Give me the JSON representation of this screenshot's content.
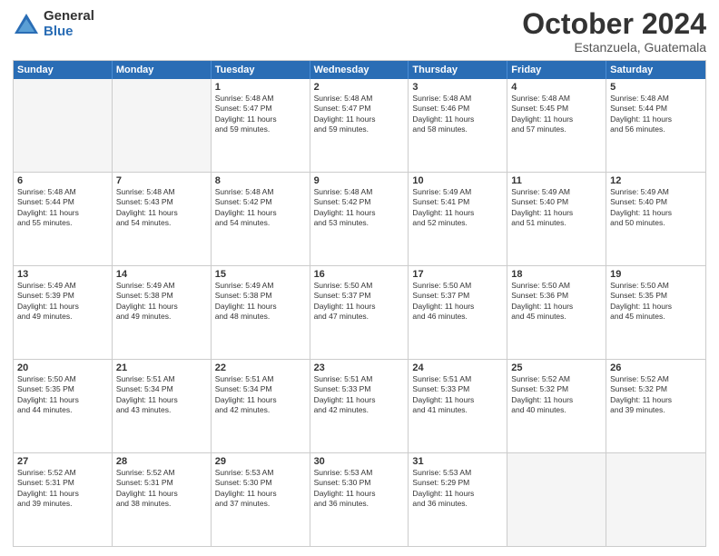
{
  "header": {
    "logo_general": "General",
    "logo_blue": "Blue",
    "month_title": "October 2024",
    "location": "Estanzuela, Guatemala"
  },
  "weekdays": [
    "Sunday",
    "Monday",
    "Tuesday",
    "Wednesday",
    "Thursday",
    "Friday",
    "Saturday"
  ],
  "rows": [
    [
      {
        "day": "",
        "empty": true,
        "lines": []
      },
      {
        "day": "",
        "empty": true,
        "lines": []
      },
      {
        "day": "1",
        "lines": [
          "Sunrise: 5:48 AM",
          "Sunset: 5:47 PM",
          "Daylight: 11 hours",
          "and 59 minutes."
        ]
      },
      {
        "day": "2",
        "lines": [
          "Sunrise: 5:48 AM",
          "Sunset: 5:47 PM",
          "Daylight: 11 hours",
          "and 59 minutes."
        ]
      },
      {
        "day": "3",
        "lines": [
          "Sunrise: 5:48 AM",
          "Sunset: 5:46 PM",
          "Daylight: 11 hours",
          "and 58 minutes."
        ]
      },
      {
        "day": "4",
        "lines": [
          "Sunrise: 5:48 AM",
          "Sunset: 5:45 PM",
          "Daylight: 11 hours",
          "and 57 minutes."
        ]
      },
      {
        "day": "5",
        "lines": [
          "Sunrise: 5:48 AM",
          "Sunset: 5:44 PM",
          "Daylight: 11 hours",
          "and 56 minutes."
        ]
      }
    ],
    [
      {
        "day": "6",
        "lines": [
          "Sunrise: 5:48 AM",
          "Sunset: 5:44 PM",
          "Daylight: 11 hours",
          "and 55 minutes."
        ]
      },
      {
        "day": "7",
        "lines": [
          "Sunrise: 5:48 AM",
          "Sunset: 5:43 PM",
          "Daylight: 11 hours",
          "and 54 minutes."
        ]
      },
      {
        "day": "8",
        "lines": [
          "Sunrise: 5:48 AM",
          "Sunset: 5:42 PM",
          "Daylight: 11 hours",
          "and 54 minutes."
        ]
      },
      {
        "day": "9",
        "lines": [
          "Sunrise: 5:48 AM",
          "Sunset: 5:42 PM",
          "Daylight: 11 hours",
          "and 53 minutes."
        ]
      },
      {
        "day": "10",
        "lines": [
          "Sunrise: 5:49 AM",
          "Sunset: 5:41 PM",
          "Daylight: 11 hours",
          "and 52 minutes."
        ]
      },
      {
        "day": "11",
        "lines": [
          "Sunrise: 5:49 AM",
          "Sunset: 5:40 PM",
          "Daylight: 11 hours",
          "and 51 minutes."
        ]
      },
      {
        "day": "12",
        "lines": [
          "Sunrise: 5:49 AM",
          "Sunset: 5:40 PM",
          "Daylight: 11 hours",
          "and 50 minutes."
        ]
      }
    ],
    [
      {
        "day": "13",
        "lines": [
          "Sunrise: 5:49 AM",
          "Sunset: 5:39 PM",
          "Daylight: 11 hours",
          "and 49 minutes."
        ]
      },
      {
        "day": "14",
        "lines": [
          "Sunrise: 5:49 AM",
          "Sunset: 5:38 PM",
          "Daylight: 11 hours",
          "and 49 minutes."
        ]
      },
      {
        "day": "15",
        "lines": [
          "Sunrise: 5:49 AM",
          "Sunset: 5:38 PM",
          "Daylight: 11 hours",
          "and 48 minutes."
        ]
      },
      {
        "day": "16",
        "lines": [
          "Sunrise: 5:50 AM",
          "Sunset: 5:37 PM",
          "Daylight: 11 hours",
          "and 47 minutes."
        ]
      },
      {
        "day": "17",
        "lines": [
          "Sunrise: 5:50 AM",
          "Sunset: 5:37 PM",
          "Daylight: 11 hours",
          "and 46 minutes."
        ]
      },
      {
        "day": "18",
        "lines": [
          "Sunrise: 5:50 AM",
          "Sunset: 5:36 PM",
          "Daylight: 11 hours",
          "and 45 minutes."
        ]
      },
      {
        "day": "19",
        "lines": [
          "Sunrise: 5:50 AM",
          "Sunset: 5:35 PM",
          "Daylight: 11 hours",
          "and 45 minutes."
        ]
      }
    ],
    [
      {
        "day": "20",
        "lines": [
          "Sunrise: 5:50 AM",
          "Sunset: 5:35 PM",
          "Daylight: 11 hours",
          "and 44 minutes."
        ]
      },
      {
        "day": "21",
        "lines": [
          "Sunrise: 5:51 AM",
          "Sunset: 5:34 PM",
          "Daylight: 11 hours",
          "and 43 minutes."
        ]
      },
      {
        "day": "22",
        "lines": [
          "Sunrise: 5:51 AM",
          "Sunset: 5:34 PM",
          "Daylight: 11 hours",
          "and 42 minutes."
        ]
      },
      {
        "day": "23",
        "lines": [
          "Sunrise: 5:51 AM",
          "Sunset: 5:33 PM",
          "Daylight: 11 hours",
          "and 42 minutes."
        ]
      },
      {
        "day": "24",
        "lines": [
          "Sunrise: 5:51 AM",
          "Sunset: 5:33 PM",
          "Daylight: 11 hours",
          "and 41 minutes."
        ]
      },
      {
        "day": "25",
        "lines": [
          "Sunrise: 5:52 AM",
          "Sunset: 5:32 PM",
          "Daylight: 11 hours",
          "and 40 minutes."
        ]
      },
      {
        "day": "26",
        "lines": [
          "Sunrise: 5:52 AM",
          "Sunset: 5:32 PM",
          "Daylight: 11 hours",
          "and 39 minutes."
        ]
      }
    ],
    [
      {
        "day": "27",
        "lines": [
          "Sunrise: 5:52 AM",
          "Sunset: 5:31 PM",
          "Daylight: 11 hours",
          "and 39 minutes."
        ]
      },
      {
        "day": "28",
        "lines": [
          "Sunrise: 5:52 AM",
          "Sunset: 5:31 PM",
          "Daylight: 11 hours",
          "and 38 minutes."
        ]
      },
      {
        "day": "29",
        "lines": [
          "Sunrise: 5:53 AM",
          "Sunset: 5:30 PM",
          "Daylight: 11 hours",
          "and 37 minutes."
        ]
      },
      {
        "day": "30",
        "lines": [
          "Sunrise: 5:53 AM",
          "Sunset: 5:30 PM",
          "Daylight: 11 hours",
          "and 36 minutes."
        ]
      },
      {
        "day": "31",
        "lines": [
          "Sunrise: 5:53 AM",
          "Sunset: 5:29 PM",
          "Daylight: 11 hours",
          "and 36 minutes."
        ]
      },
      {
        "day": "",
        "empty": true,
        "lines": []
      },
      {
        "day": "",
        "empty": true,
        "lines": []
      }
    ]
  ]
}
